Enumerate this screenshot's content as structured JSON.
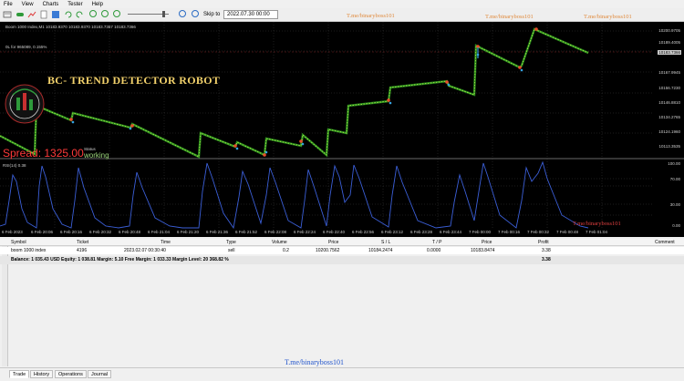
{
  "menu": [
    "File",
    "View",
    "Charts",
    "Tester",
    "Help"
  ],
  "toolbar": {
    "skip_label": "Skip to",
    "date_value": "2022.07.30 00:00"
  },
  "watermarks": {
    "top1": "T.me/binaryboss101",
    "top2": "T.me/binaryboss101",
    "top3": "T.me/binaryboss101",
    "chart": "T.me/binaryboss101",
    "bottom": "T.me/binaryboss101"
  },
  "chart": {
    "info_top": "Boom 1000 Index,M1  10183.9370 10183.9370 10183.7367 10183.7366",
    "info_2": "0L for 965089, 0.155%",
    "title": "BC- TREND DETECTOR ROBOT",
    "spread_label": "Spread:",
    "spread_value": "1325.00",
    "status_label": "Status",
    "status_value": "working",
    "rsi_label": "RSI(14) 0.38",
    "y_ticks": [
      "10200.9705",
      "10189.4005",
      "10183.7366",
      "10167.9945",
      "10156.7230",
      "10146.8810",
      "10134.2765",
      "10124.1960",
      "10113.3535"
    ],
    "price_tag": "10183.7366",
    "rsi_ticks": [
      "100.00",
      "70.00",
      "30.00",
      "0.00"
    ],
    "x_ticks": [
      "6 Feb 2023",
      "6 Feb 20:06",
      "6 Feb 20:16",
      "6 Feb 20:32",
      "6 Feb 20:48",
      "6 Feb 21:04",
      "6 Feb 21:20",
      "6 Feb 21:36",
      "6 Feb 21:52",
      "6 Feb 22:08",
      "6 Feb 22:24",
      "6 Feb 22:40",
      "6 Feb 22:56",
      "6 Feb 23:12",
      "6 Feb 23:28",
      "6 Feb 23:44",
      "7 Feb 00:00",
      "7 Feb 00:16",
      "7 Feb 00:32",
      "7 Feb 00:48",
      "7 Feb 01:04"
    ]
  },
  "table": {
    "headers": [
      "Symbol",
      "Ticket",
      "Time",
      "Type",
      "Volume",
      "Price",
      "S / L",
      "T / P",
      "Price",
      "Profit",
      "Comment"
    ],
    "row": [
      "boom 1000 index",
      "4196",
      "2023.02.07 00:30:40",
      "sell",
      "0.2",
      "10200.7562",
      "10184.2474",
      "0.0000",
      "10183.8474",
      "3.38"
    ],
    "balance": "Balance: 1 035.43 USD  Equity: 1 038.81  Margin: 5.10  Free Margin: 1 033.33  Margin Level: 20 368.82 %",
    "balance_profit": "3.38"
  },
  "tabs": [
    "Trade",
    "History",
    "Operations",
    "Journal"
  ]
}
